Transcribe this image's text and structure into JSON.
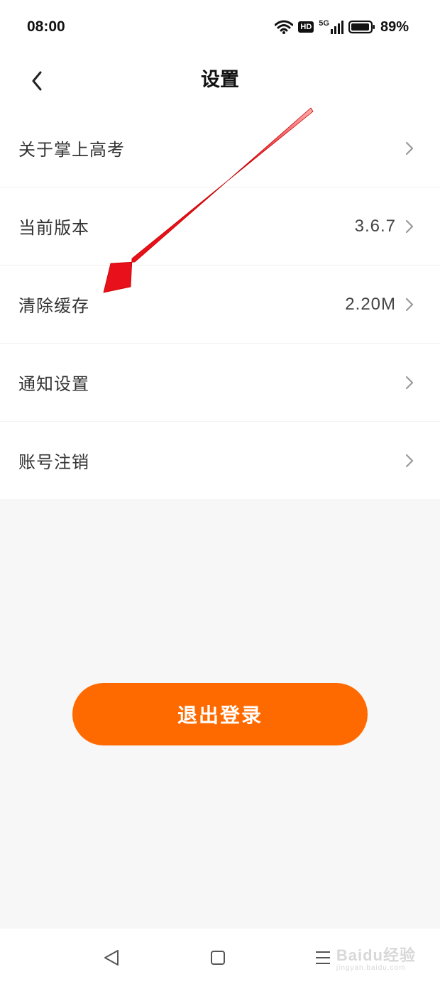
{
  "status_bar": {
    "time": "08:00",
    "network_badge": "HD",
    "network_type": "5G",
    "battery_percent": "89%",
    "icons": [
      "wifi-icon",
      "hd-icon",
      "signal-5g-icon",
      "battery-icon"
    ]
  },
  "header": {
    "title": "设置",
    "back_icon": "chevron-left-icon"
  },
  "settings": {
    "items": [
      {
        "label": "关于掌上高考",
        "value": ""
      },
      {
        "label": "当前版本",
        "value": "3.6.7"
      },
      {
        "label": "清除缓存",
        "value": "2.20M"
      },
      {
        "label": "通知设置",
        "value": ""
      },
      {
        "label": "账号注销",
        "value": ""
      }
    ]
  },
  "logout": {
    "label": "退出登录"
  },
  "nav_bar": {
    "icons": [
      "back-triangle-icon",
      "home-square-icon",
      "menu-lines-icon"
    ]
  },
  "watermark": {
    "brand": "Baidu经验",
    "sub": "jingyan.baidu.com"
  },
  "colors": {
    "accent": "#ff6a00",
    "annotation_arrow": "#e8101a",
    "background": "#f7f7f7"
  }
}
